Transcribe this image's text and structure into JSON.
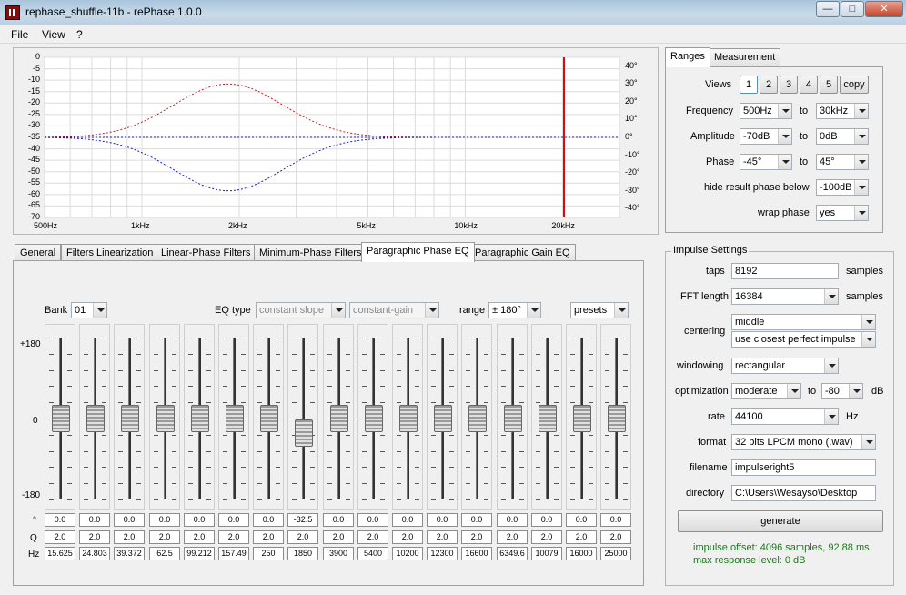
{
  "window": {
    "title": "rephase_shuffle-11b  -  rePhase 1.0.0",
    "minimize": "—",
    "maximize": "□",
    "close": "✕"
  },
  "menu": [
    "File",
    "View",
    "?"
  ],
  "graph": {
    "y_left_ticks": [
      "0",
      "-5",
      "-10",
      "-15",
      "-20",
      "-25",
      "-30",
      "-35",
      "-40",
      "-45",
      "-50",
      "-55",
      "-60",
      "-65",
      "-70"
    ],
    "y_right_ticks": [
      "40°",
      "30°",
      "20°",
      "10°",
      "0°",
      "-10°",
      "-20°",
      "-30°",
      "-40°"
    ],
    "x_ticks": [
      "500Hz",
      "1kHz",
      "2kHz",
      "5kHz",
      "10kHz",
      "20kHz"
    ],
    "colors": {
      "upper": "#cc2020",
      "lower": "#2020cc",
      "marker": "#d01010"
    }
  },
  "tabs": [
    "General",
    "Filters Linearization",
    "Linear-Phase Filters",
    "Minimum-Phase Filters",
    "Paragraphic Phase EQ",
    "Paragraphic Gain EQ"
  ],
  "eq": {
    "bank_label": "Bank",
    "bank_value": "01",
    "eqtype_label": "EQ type",
    "eqtype_value": "constant slope",
    "gain_mode": "constant-gain",
    "range_label": "range",
    "range_value": "± 180°",
    "presets": "presets",
    "scale_top": "+180",
    "scale_mid": "0",
    "scale_bot": "-180",
    "row_deg": "°",
    "row_q": "Q",
    "row_hz": "Hz",
    "bands": [
      {
        "deg": "0.0",
        "q": "2.0",
        "hz": "15.625",
        "level": 0.5
      },
      {
        "deg": "0.0",
        "q": "2.0",
        "hz": "24.803",
        "level": 0.5
      },
      {
        "deg": "0.0",
        "q": "2.0",
        "hz": "39.372",
        "level": 0.5
      },
      {
        "deg": "0.0",
        "q": "2.0",
        "hz": "62.5",
        "level": 0.5
      },
      {
        "deg": "0.0",
        "q": "2.0",
        "hz": "99.212",
        "level": 0.5
      },
      {
        "deg": "0.0",
        "q": "2.0",
        "hz": "157.49",
        "level": 0.5
      },
      {
        "deg": "0.0",
        "q": "2.0",
        "hz": "250",
        "level": 0.5
      },
      {
        "deg": "-32.5",
        "q": "2.0",
        "hz": "1850",
        "level": 0.41
      },
      {
        "deg": "0.0",
        "q": "2.0",
        "hz": "3900",
        "level": 0.5
      },
      {
        "deg": "0.0",
        "q": "2.0",
        "hz": "5400",
        "level": 0.5
      },
      {
        "deg": "0.0",
        "q": "2.0",
        "hz": "10200",
        "level": 0.5
      },
      {
        "deg": "0.0",
        "q": "2.0",
        "hz": "12300",
        "level": 0.5
      },
      {
        "deg": "0.0",
        "q": "2.0",
        "hz": "16600",
        "level": 0.5
      },
      {
        "deg": "0.0",
        "q": "2.0",
        "hz": "6349.6",
        "level": 0.5
      },
      {
        "deg": "0.0",
        "q": "2.0",
        "hz": "10079",
        "level": 0.5
      },
      {
        "deg": "0.0",
        "q": "2.0",
        "hz": "16000",
        "level": 0.5
      },
      {
        "deg": "0.0",
        "q": "2.0",
        "hz": "25000",
        "level": 0.5
      }
    ]
  },
  "ranges": {
    "tab_ranges": "Ranges",
    "tab_measurement": "Measurement",
    "views_label": "Views",
    "views": [
      "1",
      "2",
      "3",
      "4",
      "5",
      "copy"
    ],
    "frequency_label": "Frequency",
    "freq_from": "500Hz",
    "freq_to": "30kHz",
    "to": "to",
    "amplitude_label": "Amplitude",
    "amp_from": "-70dB",
    "amp_to": "0dB",
    "phase_label": "Phase",
    "phase_from": "-45°",
    "phase_to": "45°",
    "hide_label": "hide result phase below",
    "hide_value": "-100dB",
    "wrap_label": "wrap phase",
    "wrap_value": "yes"
  },
  "impulse": {
    "title": "Impulse Settings",
    "taps_label": "taps",
    "taps_value": "8192",
    "samples": "samples",
    "fft_label": "FFT length",
    "fft_value": "16384",
    "centering_label": "centering",
    "centering_value": "middle",
    "centering_mode": "use closest perfect impulse",
    "windowing_label": "windowing",
    "windowing_value": "rectangular",
    "optimization_label": "optimization",
    "optimization_value": "moderate",
    "opt_to": "to",
    "opt_db_value": "-80",
    "db": "dB",
    "rate_label": "rate",
    "rate_value": "44100",
    "hz": "Hz",
    "format_label": "format",
    "format_value": "32 bits LPCM mono (.wav)",
    "filename_label": "filename",
    "filename_value": "impulseright5",
    "directory_label": "directory",
    "directory_value": "C:\\Users\\Wesayso\\Desktop",
    "generate": "generate",
    "info1": "impulse offset: 4096 samples, 92.88 ms",
    "info2": "max response level: 0 dB"
  }
}
